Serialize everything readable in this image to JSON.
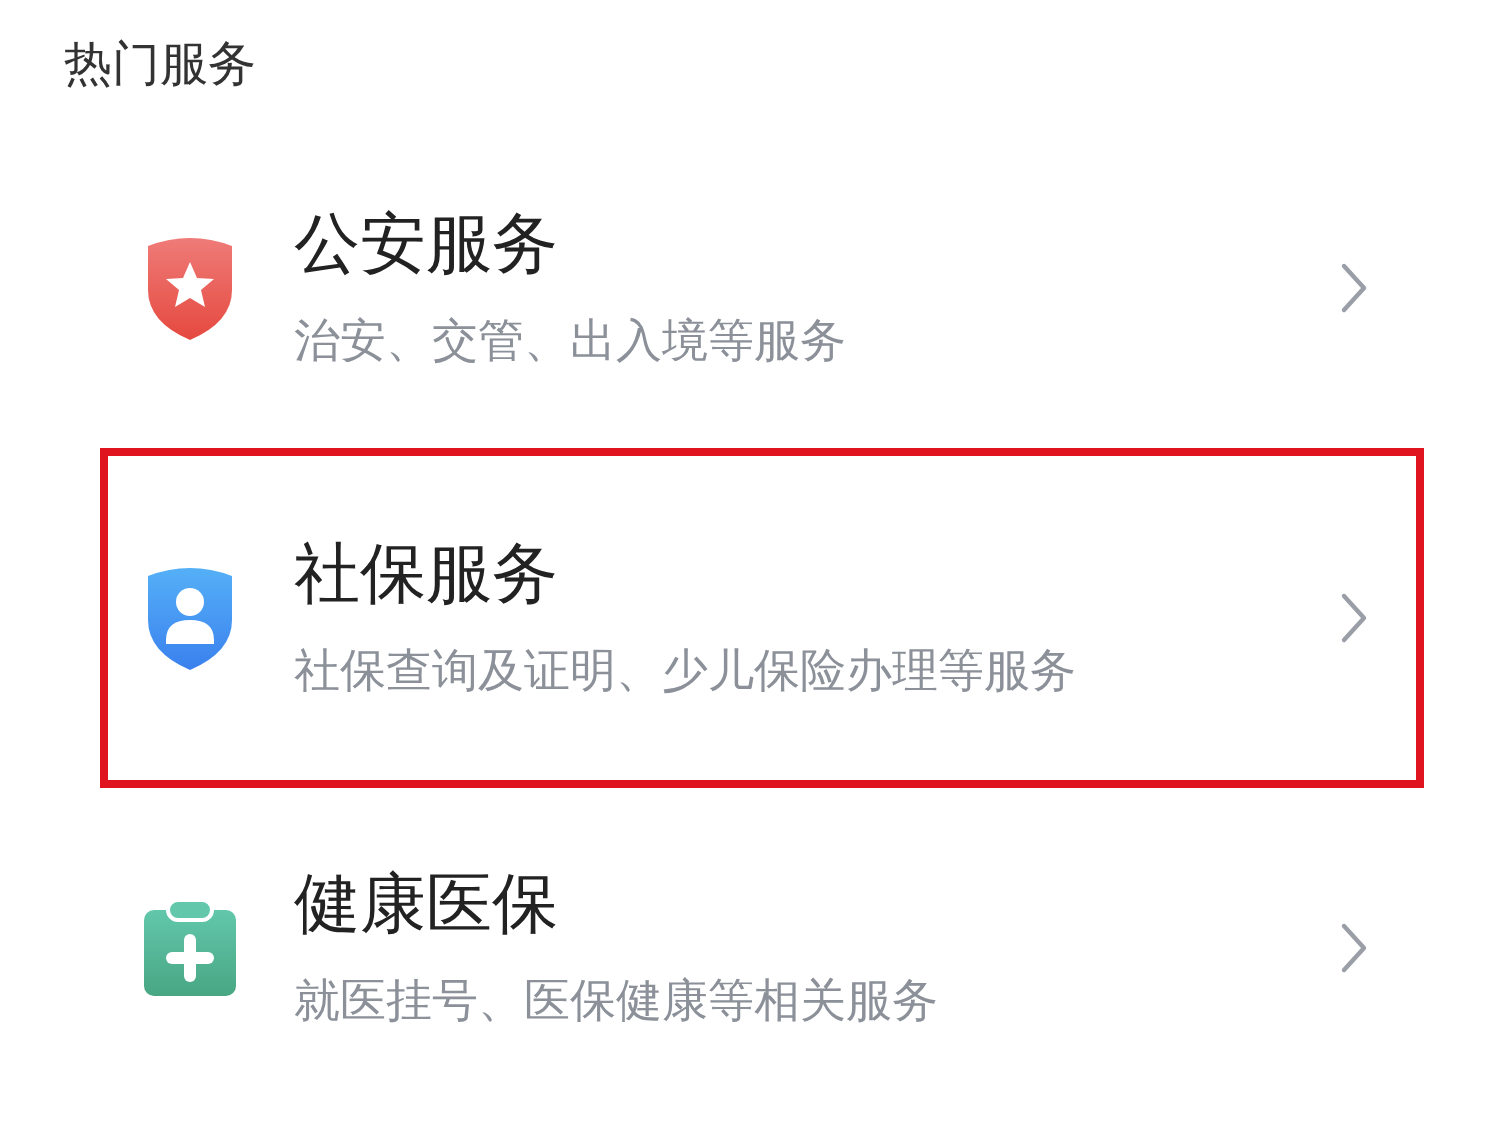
{
  "section_title": "热门服务",
  "services": [
    {
      "kind": "police",
      "title": "公安服务",
      "subtitle": "治安、交管、出入境等服务",
      "highlighted": false
    },
    {
      "kind": "social",
      "title": "社保服务",
      "subtitle": "社保查询及证明、少儿保险办理等服务",
      "highlighted": true
    },
    {
      "kind": "health",
      "title": "健康医保",
      "subtitle": "就医挂号、医保健康等相关服务",
      "highlighted": false
    }
  ]
}
